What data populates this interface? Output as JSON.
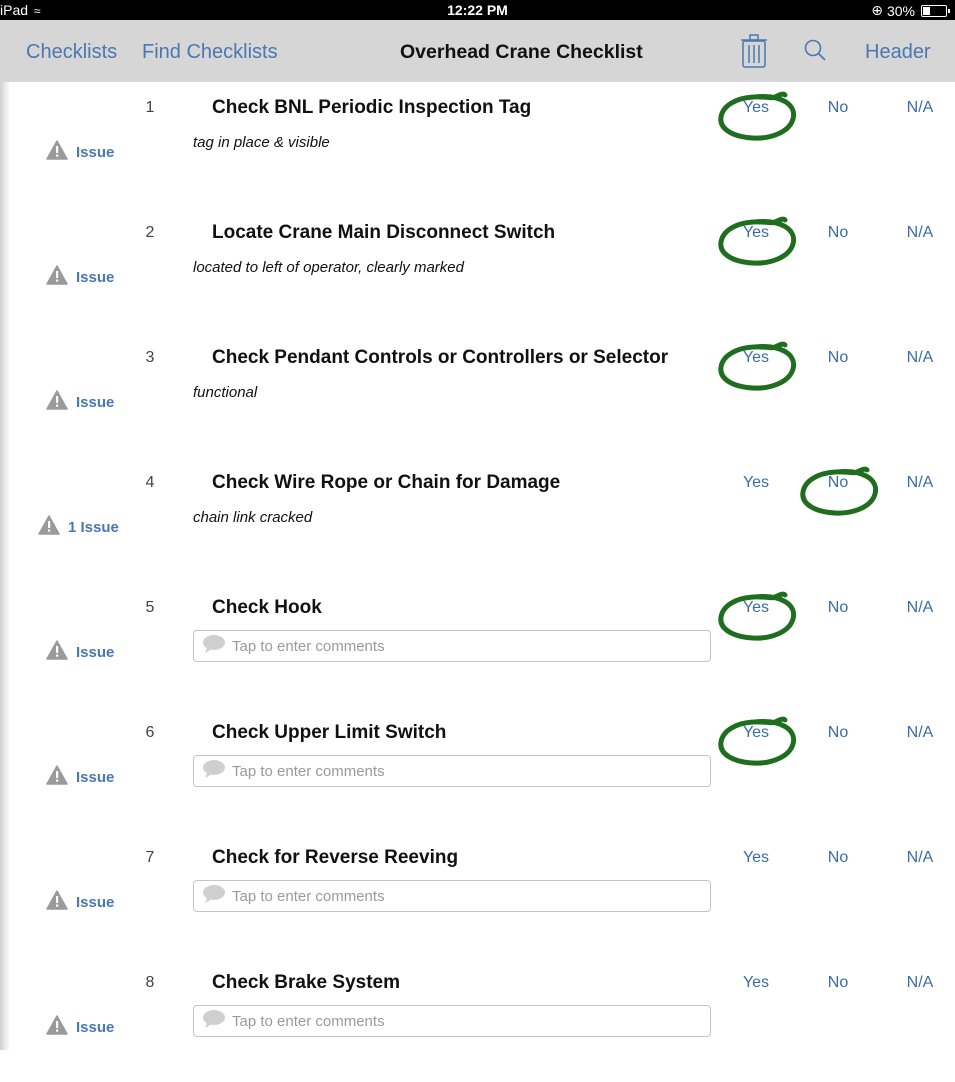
{
  "status_bar": {
    "device": "iPad",
    "time": "12:22 PM",
    "battery": "30%"
  },
  "nav": {
    "checklists": "Checklists",
    "find_checklists": "Find Checklists",
    "title": "Overhead Crane Checklist",
    "header": "Header"
  },
  "options": {
    "yes": "Yes",
    "no": "No",
    "na": "N/A"
  },
  "comment_placeholder": "Tap to enter comments",
  "items": [
    {
      "num": "1",
      "title": "Check BNL Periodic Inspection Tag",
      "note": "tag in place & visible",
      "issue": "Issue",
      "selected": "yes"
    },
    {
      "num": "2",
      "title": "Locate Crane Main Disconnect Switch",
      "note": "located to left of operator, clearly marked",
      "issue": "Issue",
      "selected": "yes"
    },
    {
      "num": "3",
      "title": "Check Pendant Controls or Controllers or Selector",
      "note": "functional",
      "issue": "Issue",
      "selected": "yes"
    },
    {
      "num": "4",
      "title": "Check Wire Rope or Chain for Damage",
      "note": "chain link cracked",
      "issue": "1 Issue",
      "selected": "no"
    },
    {
      "num": "5",
      "title": "Check Hook",
      "note": "",
      "issue": "Issue",
      "selected": "yes"
    },
    {
      "num": "6",
      "title": "Check Upper Limit Switch",
      "note": "",
      "issue": "Issue",
      "selected": "yes"
    },
    {
      "num": "7",
      "title": "Check for Reverse Reeving",
      "note": "",
      "issue": "Issue",
      "selected": ""
    },
    {
      "num": "8",
      "title": "Check Brake System",
      "note": "",
      "issue": "Issue",
      "selected": ""
    }
  ],
  "colors": {
    "link": "#4978b2",
    "option": "#3a6ca8",
    "nav_background": "#d6d6d6",
    "status_background": "#000000",
    "selection_mark": "#1f6e1f"
  },
  "icons": {
    "trash": "trash-icon",
    "search": "search-icon",
    "issue": "warning-icon",
    "comment": "speech-bubble-icon",
    "selection": "hand-drawn-circle"
  }
}
